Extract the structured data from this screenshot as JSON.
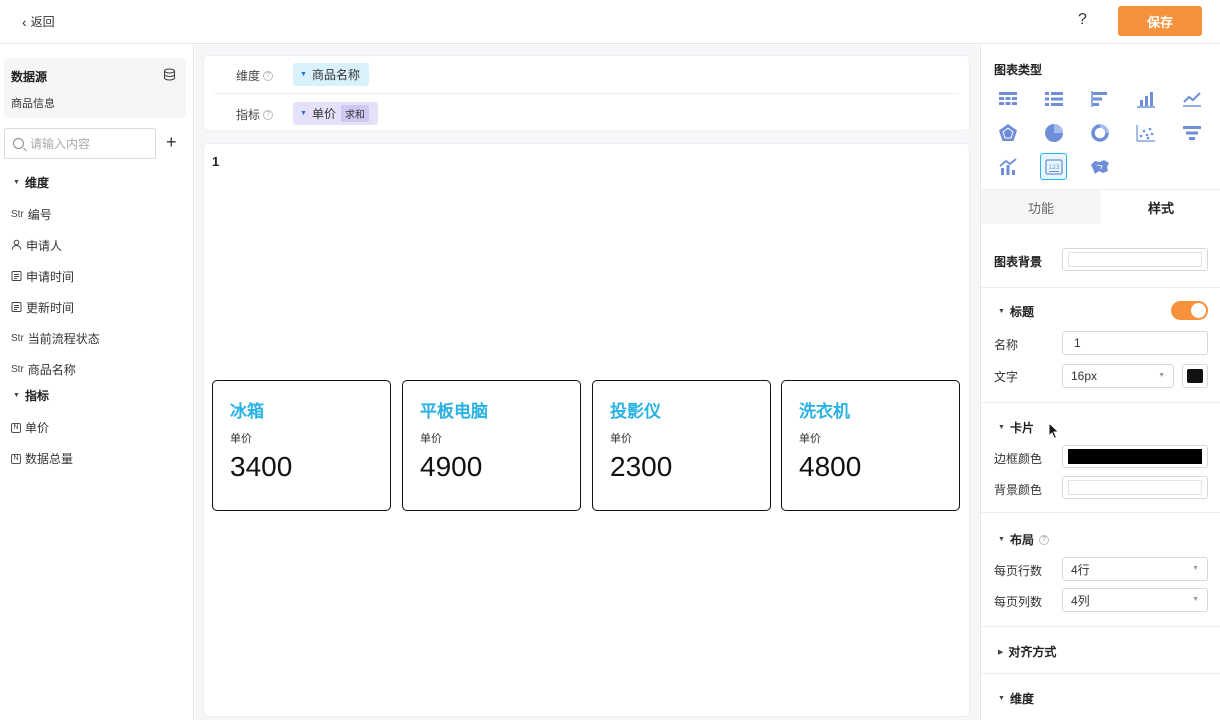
{
  "topbar": {
    "back_label": "返回",
    "help_label": "?",
    "save_label": "保存"
  },
  "left": {
    "datasource_title": "数据源",
    "datasource_name": "商品信息",
    "search_placeholder": "请输入内容",
    "dimension_header": "维度",
    "dimensions": [
      {
        "icon": "str-tag",
        "tag": "Str",
        "label": "编号"
      },
      {
        "icon": "person-icon",
        "tag": "",
        "label": "申请人"
      },
      {
        "icon": "calendar-icon",
        "tag": "",
        "label": "申请时间"
      },
      {
        "icon": "calendar-icon",
        "tag": "",
        "label": "更新时间"
      },
      {
        "icon": "str-tag",
        "tag": "Str",
        "label": "当前流程状态"
      },
      {
        "icon": "str-tag",
        "tag": "Str",
        "label": "商品名称"
      }
    ],
    "metric_header": "指标",
    "metrics": [
      {
        "icon": "number-icon",
        "tag": "N",
        "label": "单价"
      },
      {
        "icon": "number-icon",
        "tag": "N",
        "label": "数据总量"
      }
    ]
  },
  "config": {
    "dimension_label": "维度",
    "dimension_value": "商品名称",
    "metric_label": "指标",
    "metric_value": "单价",
    "metric_agg": "求和"
  },
  "canvas": {
    "title": "1",
    "cards": [
      {
        "name": "冰箱",
        "metric": "单价",
        "value": "3400"
      },
      {
        "name": "平板电脑",
        "metric": "单价",
        "value": "4900"
      },
      {
        "name": "投影仪",
        "metric": "单价",
        "value": "2300"
      },
      {
        "name": "洗衣机",
        "metric": "单价",
        "value": "4800"
      }
    ]
  },
  "right": {
    "chart_type_title": "图表类型",
    "chart_types": [
      "table-icon",
      "detail-table-icon",
      "horizontal-bar-icon",
      "bar-chart-icon",
      "line-chart-icon",
      "radar-icon",
      "pie-chart-icon",
      "donut-chart-icon",
      "scatter-icon",
      "funnel-icon",
      "combo-chart-icon",
      "indicator-card-icon",
      "map-icon"
    ],
    "selected_chart_type": "indicator-card-icon",
    "tab_function": "功能",
    "tab_style": "样式",
    "chart_bg_label": "图表背景",
    "title_section": "标题",
    "title_name_label": "名称",
    "title_name_value": "1",
    "title_text_label": "文字",
    "title_font_size": "16px",
    "card_section": "卡片",
    "card_border_label": "边框颜色",
    "card_bg_label": "背景颜色",
    "layout_section": "布局",
    "rows_label": "每页行数",
    "rows_value": "4行",
    "cols_label": "每页列数",
    "cols_value": "4列",
    "align_section": "对齐方式",
    "dimension_section": "维度"
  },
  "colors": {
    "accent": "#f7913c",
    "card_title": "#29b2e3",
    "icon_blue": "#6e8fd8",
    "title_color": "#111111",
    "card_border": "#000000",
    "card_bg": "#ffffff",
    "chart_bg": "#ffffff"
  }
}
